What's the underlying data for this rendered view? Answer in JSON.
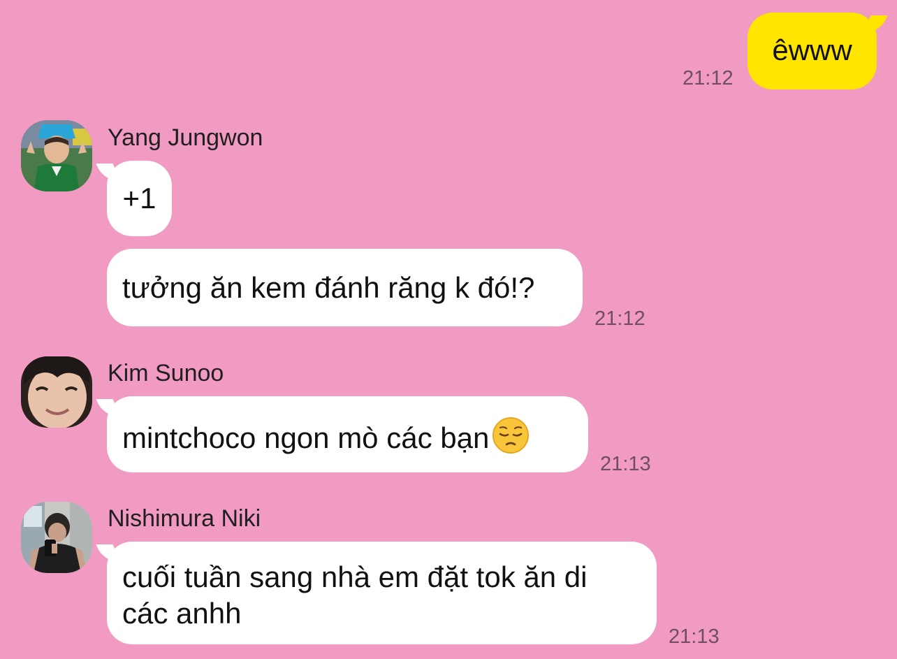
{
  "messages": [
    {
      "type": "outgoing",
      "text": "êwww",
      "time": "21:12"
    },
    {
      "type": "incoming",
      "sender": "Yang Jungwon",
      "avatar": "avatar-yang-jungwon",
      "bubbles": [
        {
          "text": "+1"
        },
        {
          "text": "tưởng ăn kem đánh răng k đó!?",
          "time": "21:12"
        }
      ]
    },
    {
      "type": "incoming",
      "sender": "Kim Sunoo",
      "avatar": "avatar-kim-sunoo",
      "bubbles": [
        {
          "text": "mintchoco ngon mò các bạn",
          "emoji": "pensive-face-emoji",
          "time": "21:13"
        }
      ]
    },
    {
      "type": "incoming",
      "sender": "Nishimura Niki",
      "avatar": "avatar-nishimura-niki",
      "bubbles": [
        {
          "text_line1": "cuối tuần sang nhà em đặt tok ăn di",
          "text_line2": "các anhh",
          "time": "21:13"
        }
      ]
    }
  ],
  "colors": {
    "background": "#f29bc2",
    "incoming_bubble": "#ffffff",
    "outgoing_bubble": "#ffe500",
    "timestamp": "#6e4f5f"
  }
}
